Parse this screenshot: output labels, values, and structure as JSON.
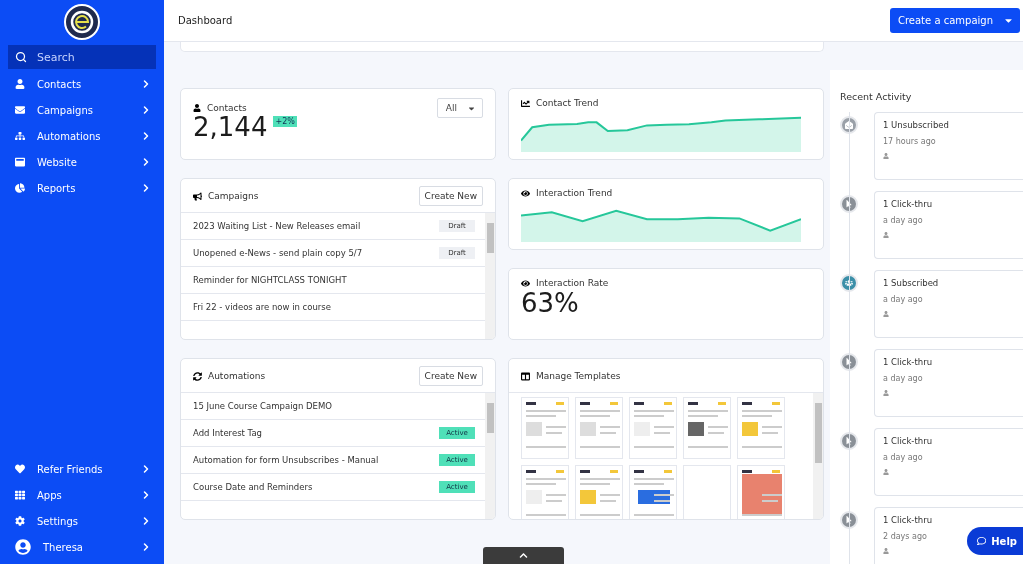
{
  "sidebar": {
    "search": {
      "placeholder": "Search"
    },
    "items": [
      {
        "label": "Contacts",
        "kind": "person"
      },
      {
        "label": "Campaigns",
        "kind": "mail"
      },
      {
        "label": "Automations",
        "kind": "flow"
      },
      {
        "label": "Website",
        "kind": "browser"
      },
      {
        "label": "Reports",
        "kind": "pie"
      }
    ],
    "bottom_items": [
      {
        "label": "Refer Friends",
        "kind": "heart"
      },
      {
        "label": "Apps",
        "kind": "grid"
      },
      {
        "label": "Settings",
        "kind": "gear"
      },
      {
        "label": "Theresa",
        "kind": "avatar"
      }
    ]
  },
  "header": {
    "title": "Dashboard",
    "button": "Create a campaign"
  },
  "contacts": {
    "title": "Contacts",
    "filter": "All",
    "count": "2,144",
    "change": "+2%"
  },
  "campaigns": {
    "title": "Campaigns",
    "button": "Create New",
    "rows": [
      {
        "name": "2023 Waiting List - New Releases email",
        "status": "Draft",
        "kind": "draft"
      },
      {
        "name": "Unopened e-News - send plain copy 5/7",
        "status": "Draft",
        "kind": "draft"
      },
      {
        "name": "Reminder for NIGHTCLASS TONIGHT"
      },
      {
        "name": "Fri 22 - videos are now in course"
      }
    ]
  },
  "automations": {
    "title": "Automations",
    "button": "Create New",
    "rows": [
      {
        "name": "15 June Course Campaign DEMO"
      },
      {
        "name": "Add Interest Tag",
        "status": "Active",
        "kind": "active"
      },
      {
        "name": "Automation for form Unsubscribes - Manual",
        "status": "Active",
        "kind": "active"
      },
      {
        "name": "Course Date and Reminders",
        "status": "Active",
        "kind": "active"
      }
    ]
  },
  "contact_trend": {
    "title": "Contact Trend"
  },
  "interaction_trend": {
    "title": "Interaction Trend"
  },
  "interaction_rate": {
    "title": "Interaction Rate",
    "value": "63%"
  },
  "templates": {
    "title": "Manage Templates",
    "items": [
      {
        "kind": "text"
      },
      {
        "kind": "text"
      },
      {
        "kind": "letter"
      },
      {
        "kind": "news"
      },
      {
        "kind": "flyer"
      },
      {
        "kind": "letter"
      },
      {
        "kind": "flyer"
      },
      {
        "kind": "app"
      },
      {
        "kind": "blank"
      },
      {
        "kind": "photo"
      }
    ]
  },
  "recent_activity": {
    "title": "Recent Activity",
    "items": [
      {
        "title": "1 Unsubscribed",
        "time": "17 hours ago",
        "kind": "unsubscribed"
      },
      {
        "title": "1 Click-thru",
        "time": "a day ago",
        "kind": "click"
      },
      {
        "title": "1 Subscribed",
        "time": "a day ago",
        "kind": "subscribed"
      },
      {
        "title": "1 Click-thru",
        "time": "a day ago",
        "kind": "click"
      },
      {
        "title": "1 Click-thru",
        "time": "a day ago",
        "kind": "click"
      },
      {
        "title": "1 Click-thru",
        "time": "2 days ago",
        "kind": "click"
      }
    ]
  },
  "help_button": "Help"
}
